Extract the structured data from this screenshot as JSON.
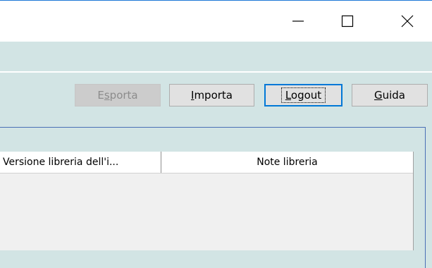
{
  "window": {
    "controls": {
      "minimize_icon": "minimize-icon",
      "maximize_icon": "maximize-icon",
      "close_icon": "close-icon"
    }
  },
  "toolbar": {
    "export": {
      "pre": "E",
      "underline": "s",
      "post": "porta",
      "enabled": false
    },
    "import": {
      "pre": "",
      "underline": "I",
      "post": "mporta"
    },
    "logout": {
      "pre": "",
      "underline": "L",
      "post": "ogout",
      "focused": true
    },
    "help": {
      "pre": "",
      "underline": "G",
      "post": "uida"
    }
  },
  "table": {
    "columns": [
      {
        "label": "Versione libreria dell'i..."
      },
      {
        "label": "Note libreria"
      }
    ]
  },
  "colors": {
    "window_background": "#d2e4e4",
    "title_bar": "#ffffff",
    "focus_border": "#0078d7",
    "panel_border": "#4a6fb5"
  }
}
